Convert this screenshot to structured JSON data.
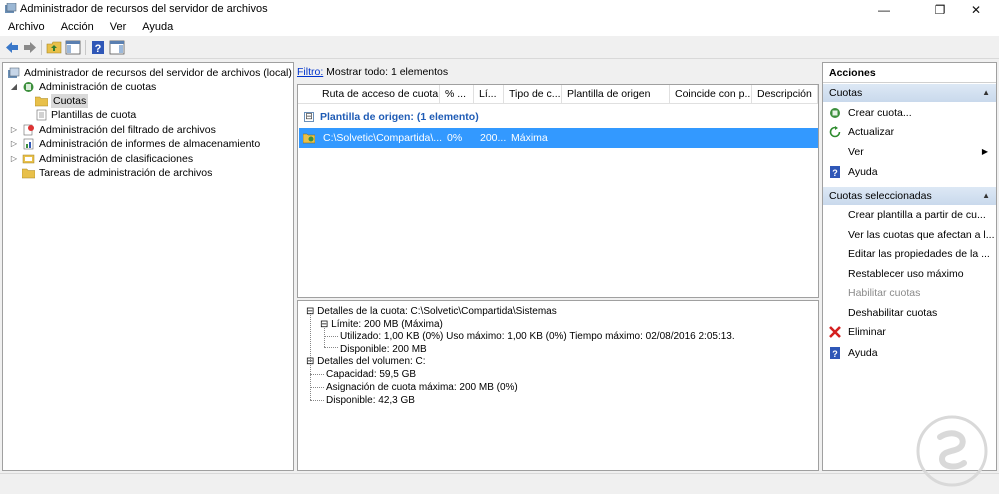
{
  "window": {
    "title": "Administrador de recursos del servidor de archivos"
  },
  "menu": [
    "Archivo",
    "Acción",
    "Ver",
    "Ayuda"
  ],
  "tree": {
    "root": "Administrador de recursos del servidor de archivos (local)",
    "quota_admin": "Administración de cuotas",
    "quotas": "Cuotas",
    "quota_templates": "Plantillas de cuota",
    "file_screening": "Administración del filtrado de archivos",
    "storage_reports": "Administración de informes de almacenamiento",
    "classification": "Administración de clasificaciones",
    "file_tasks": "Tareas de administración de archivos"
  },
  "filter": {
    "link": "Filtro:",
    "text": "Mostrar todo: 1 elementos"
  },
  "list": {
    "columns": [
      "Ruta de acceso de cuota",
      "% ...",
      "Lí...",
      "Tipo de c...",
      "Plantilla de origen",
      "Coincide con p...",
      "Descripción"
    ],
    "group_label": "Plantilla de origen: (1 elemento)",
    "group_toggle": "⊟",
    "rows": [
      {
        "path": "C:\\Solvetic\\Compartida\\...",
        "percent": "0%",
        "limit": "200...",
        "type": "Máxima"
      }
    ]
  },
  "details": {
    "quota_details": "Detalles de la cuota: C:\\Solvetic\\Compartida\\Sistemas",
    "limit": "Límite: 200 MB (Máxima)",
    "used": "Utilizado: 1,00 KB (0%) Uso máximo: 1,00 KB (0%) Tiempo máximo: 02/08/2016 2:05:13.",
    "available_q": "Disponible: 200 MB",
    "volume_details": "Detalles del volumen: C:",
    "capacity": "Capacidad: 59,5 GB",
    "max_assign": "Asignación de cuota máxima: 200 MB (0%)",
    "available_v": "Disponible: 42,3 GB"
  },
  "actions": {
    "header": "Acciones",
    "section1": "Cuotas",
    "items1": [
      {
        "label": "Crear cuota...",
        "icon": "create-quota-icon"
      },
      {
        "label": "Actualizar",
        "icon": "refresh-icon"
      },
      {
        "label": "Ver",
        "icon": ""
      },
      {
        "label": "Ayuda",
        "icon": "help-icon"
      }
    ],
    "section2": "Cuotas seleccionadas",
    "items2": [
      {
        "label": "Crear plantilla a partir de cu..."
      },
      {
        "label": "Ver las cuotas que afectan a l..."
      },
      {
        "label": "Editar las propiedades de la ..."
      },
      {
        "label": "Restablecer uso máximo"
      },
      {
        "label": "Habilitar cuotas",
        "disabled": true
      },
      {
        "label": "Deshabilitar cuotas"
      },
      {
        "label": "Eliminar",
        "icon": "delete-icon"
      },
      {
        "label": "Ayuda",
        "icon": "help-icon"
      }
    ]
  },
  "colors": {
    "selection": "#3399ff",
    "group_text": "#1e5bb5",
    "section_bg": "#c9d9ec"
  }
}
